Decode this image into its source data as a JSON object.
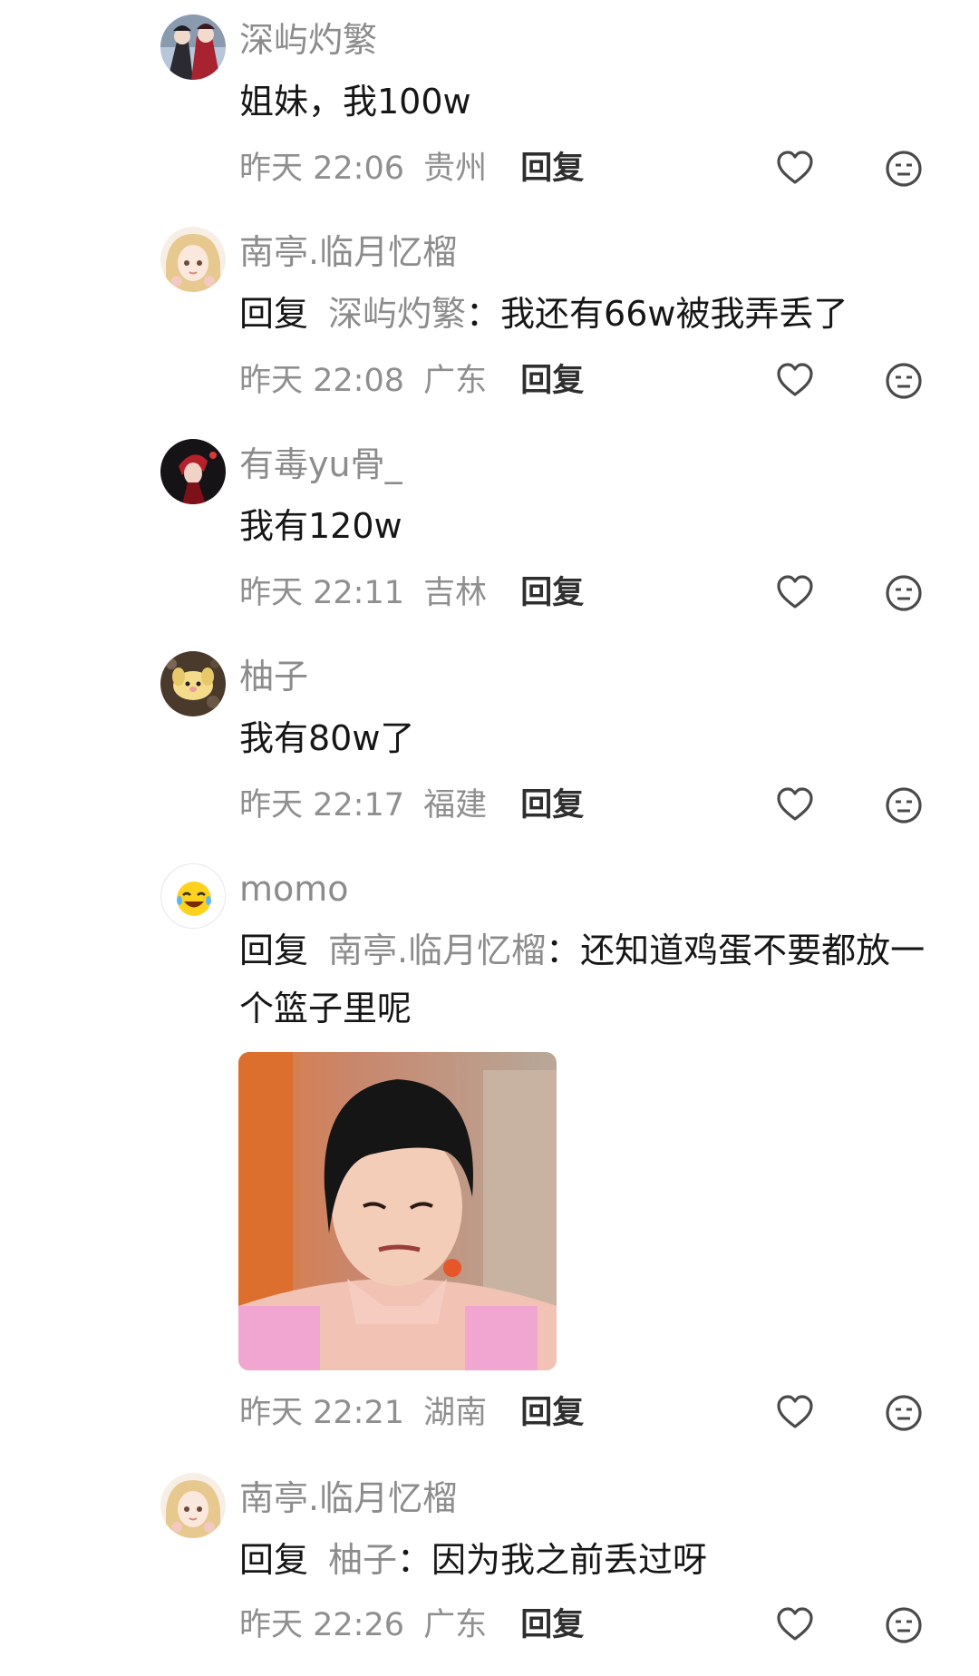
{
  "comments": [
    {
      "username": "深屿灼繁",
      "content": "姐妹，我100w",
      "time": "昨天 22:06",
      "location": "贵州",
      "reply_label": "回复",
      "avatar_icon": "anime-avatar-icon"
    },
    {
      "username": "南亭.临月忆榴",
      "reply_prefix": "回复",
      "reply_target": "深屿灼繁",
      "content": "：我还有66w被我弄丢了",
      "time": "昨天 22:08",
      "location": "广东",
      "reply_label": "回复",
      "avatar_icon": "anime-girl-avatar-icon"
    },
    {
      "username": "有毒yu骨_",
      "content": "我有120w",
      "time": "昨天 22:11",
      "location": "吉林",
      "reply_label": "回复",
      "avatar_icon": "dark-red-avatar-icon"
    },
    {
      "username": "柚子",
      "content": "我有80w了",
      "time": "昨天 22:17",
      "location": "福建",
      "reply_label": "回复",
      "avatar_icon": "puppy-avatar-icon"
    },
    {
      "username": "momo",
      "reply_prefix": "回复",
      "reply_target": "南亭.临月忆榴",
      "content": "：还知道鸡蛋不要都放一个篮子里呢",
      "time": "昨天 22:21",
      "location": "湖南",
      "reply_label": "回复",
      "avatar_icon": "laughing-emoji-avatar-icon",
      "sticker": "reaction-meme-image"
    },
    {
      "username": "南亭.临月忆榴",
      "reply_prefix": "回复",
      "reply_target": "柚子",
      "content": "：因为我之前丢过呀",
      "time": "昨天 22:26",
      "location": "广东",
      "reply_label": "回复",
      "avatar_icon": "anime-girl-avatar-icon"
    }
  ],
  "icons": {
    "like": "heart-outline-icon",
    "dislike": "neutral-face-icon"
  },
  "colors": {
    "username": "#8c8c8c",
    "meta": "#8f8f8f",
    "text": "#161616",
    "icon": "#4a4a4a"
  }
}
